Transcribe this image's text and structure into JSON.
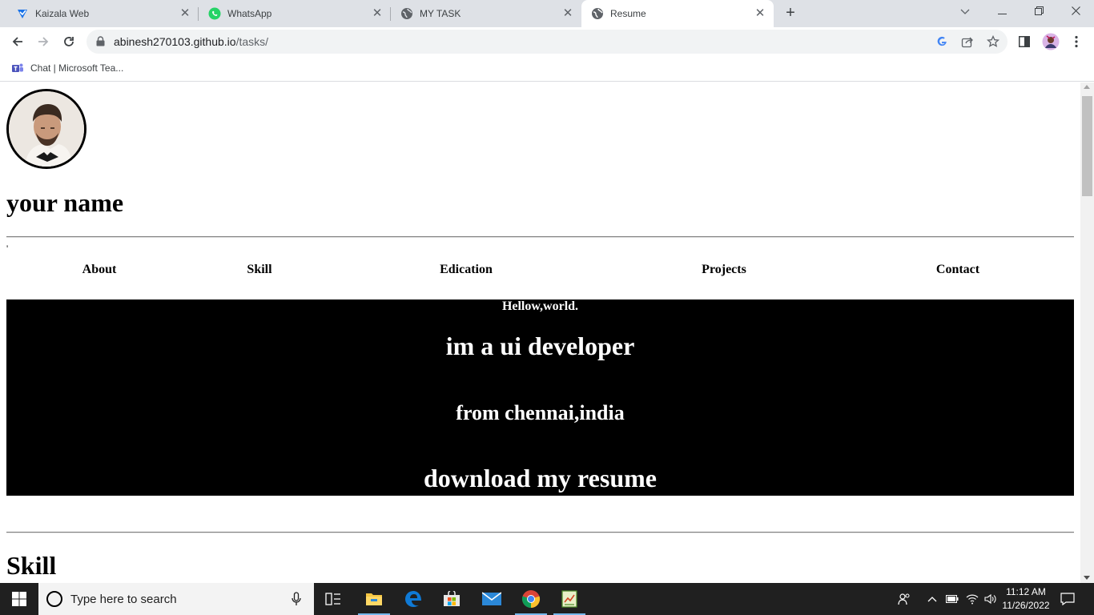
{
  "browser": {
    "tabs": [
      {
        "title": "Kaizala Web",
        "icon": "kaizala-icon"
      },
      {
        "title": "WhatsApp",
        "icon": "whatsapp-icon"
      },
      {
        "title": "MY TASK",
        "icon": "globe-icon"
      },
      {
        "title": "Resume",
        "icon": "globe-icon",
        "active": true
      }
    ],
    "url_host": "abinesh270103.github.io",
    "url_path": "/tasks/",
    "bookmarks": [
      {
        "label": "Chat | Microsoft Tea...",
        "icon": "teams-icon"
      }
    ]
  },
  "page": {
    "name_heading": "your name",
    "stray_text": "'",
    "nav": [
      "About",
      "Skill",
      "Edication",
      "Projects",
      "Contact"
    ],
    "hero": {
      "greeting": "Hellow,world.",
      "role": "im a ui developer",
      "location": "from chennai,india",
      "cta": "download my resume"
    },
    "section_title": "Skill"
  },
  "taskbar": {
    "search_placeholder": "Type here to search",
    "time": "11:12 AM",
    "date": "11/26/2022",
    "apps": [
      "task-view-icon",
      "file-explorer-icon",
      "edge-icon",
      "store-icon",
      "mail-icon",
      "chrome-icon",
      "sheets-icon"
    ]
  },
  "colors": {
    "hero_background": "#000000",
    "hero_text": "#ffffff",
    "tabstrip": "#dee1e6",
    "taskbar": "#202020"
  }
}
